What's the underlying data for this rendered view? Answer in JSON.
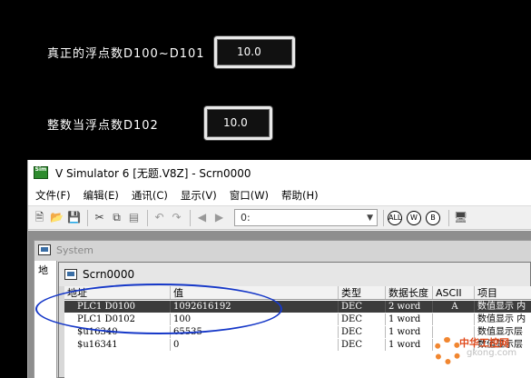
{
  "hmi": {
    "label_1": "真正的浮点数D100~D101",
    "value_1": "10.0",
    "label_2": "整数当浮点数D102",
    "value_2": "10.0"
  },
  "window": {
    "title": "V Simulator 6 [无题.V8Z] - Scrn0000",
    "app_icon_text": "Sim"
  },
  "menu": [
    "文件(F)",
    "编辑(E)",
    "通讯(C)",
    "显示(V)",
    "窗口(W)",
    "帮助(H)"
  ],
  "toolbar": {
    "combo_value": "0:",
    "mode_buttons": [
      "ALL",
      "W",
      "B"
    ]
  },
  "system_window": {
    "title": "System",
    "left_label": "地"
  },
  "screen_window": {
    "title": "Scrn0000"
  },
  "table": {
    "columns": [
      "地址",
      "值",
      "类型",
      "数据长度",
      "ASCII",
      "项目"
    ],
    "rows": [
      {
        "addr": "PLC1 D0100",
        "value": "1092616192",
        "type": "DEC",
        "len": "2 word",
        "ascii": "A",
        "item": "数值显示 内"
      },
      {
        "addr": "PLC1 D0102",
        "value": "100",
        "type": "DEC",
        "len": "1 word",
        "ascii": "",
        "item": "数值显示 内"
      },
      {
        "addr": "$u16340",
        "value": "65535",
        "type": "DEC",
        "len": "1 word",
        "ascii": "",
        "item": "数值显示层"
      },
      {
        "addr": "$u16341",
        "value": "0",
        "type": "DEC",
        "len": "1 word",
        "ascii": "",
        "item": "数值显示层"
      }
    ]
  },
  "watermark": {
    "text": "中华工控网",
    "sub": "gkong.com"
  },
  "colors": {
    "annotation": "#1638c8",
    "selected_row": "#3c3c3c"
  }
}
